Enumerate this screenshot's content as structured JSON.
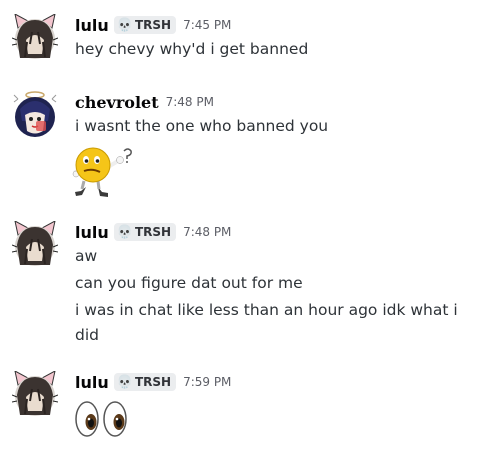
{
  "messages": [
    {
      "username": "lulu",
      "tag": "TRSH",
      "tag_icon": "skull-icon",
      "time": "7:45 PM",
      "lines": [
        "hey chevy why'd i get banned"
      ]
    },
    {
      "username": "chevrolet",
      "time": "7:48 PM",
      "lines": [
        "i wasnt the one who banned you"
      ],
      "attachment": "confused-emoji-sticker"
    },
    {
      "username": "lulu",
      "tag": "TRSH",
      "tag_icon": "skull-icon",
      "time": "7:48 PM",
      "lines": [
        "aw",
        "can you figure dat out for me",
        "i was in chat like less than an hour ago idk what i",
        "did"
      ]
    },
    {
      "username": "lulu",
      "tag": "TRSH",
      "tag_icon": "skull-icon",
      "time": "7:59 PM",
      "emoji": "👀"
    }
  ],
  "colors": {
    "background": "#ffffff",
    "username": "#060607",
    "message_text": "#2e3338",
    "timestamp": "#5c5e66",
    "tag_bg": "#ebedef"
  }
}
